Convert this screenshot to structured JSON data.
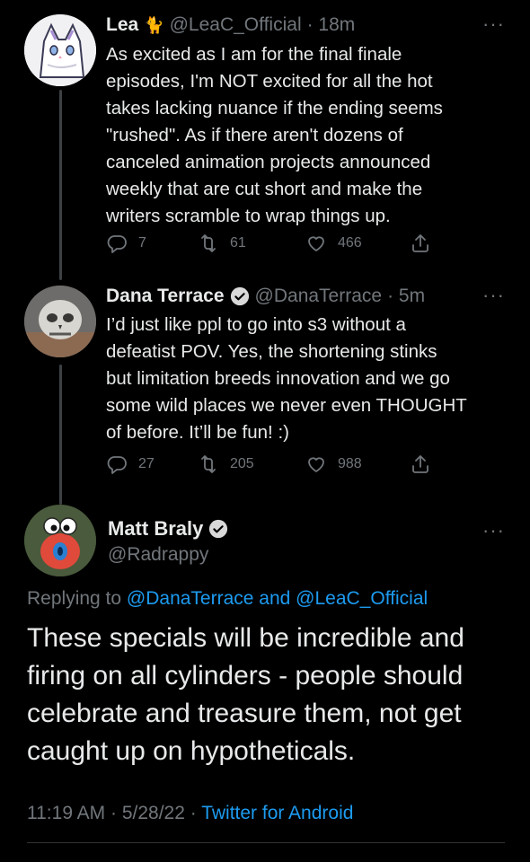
{
  "tweets": [
    {
      "name": "Lea",
      "emoji": "🐈",
      "handle": "@LeaC_Official",
      "time": "· 18m",
      "more": "···",
      "text": "As excited as I am for the final finale\nepisodes, I'm NOT excited for all the hot\ntakes lacking nuance if the ending seems\n\"rushed\". As if there aren't dozens of\ncanceled animation projects announced\nweekly that are cut short and make the\nwriters scramble to wrap things up.",
      "replies": "7",
      "retweets": "61",
      "likes": "466"
    },
    {
      "name": "Dana Terrace",
      "handle": "@DanaTerrace",
      "time": "· 5m",
      "more": "···",
      "text": "I’d just like ppl to go into s3 without a\ndefeatist POV. Yes, the shortening stinks\nbut limitation breeds innovation and we go\nsome wild places we never even THOUGHT\nof before. It’ll be fun! :)",
      "replies": "27",
      "retweets": "205",
      "likes": "988"
    }
  ],
  "main": {
    "name": "Matt Braly",
    "handle": "@Radrappy",
    "more": "···",
    "replying_prefix": "Replying to ",
    "replying_user1": "@DanaTerrace",
    "replying_and": " and ",
    "replying_user2": "@LeaC_Official",
    "text": "These specials will be incredible and firing on all cylinders - people should celebrate and treasure them, not get caught up on hypotheticals.",
    "time": "11:19 AM · 5/28/22 · ",
    "source": "Twitter for Android"
  },
  "colors": {
    "background": "#000000",
    "link": "#1d9bf0",
    "muted": "#71767b",
    "verified": "#d9d9d9"
  },
  "icons": [
    "reply-icon",
    "retweet-icon",
    "like-icon",
    "share-icon",
    "verified-icon",
    "more-icon"
  ]
}
